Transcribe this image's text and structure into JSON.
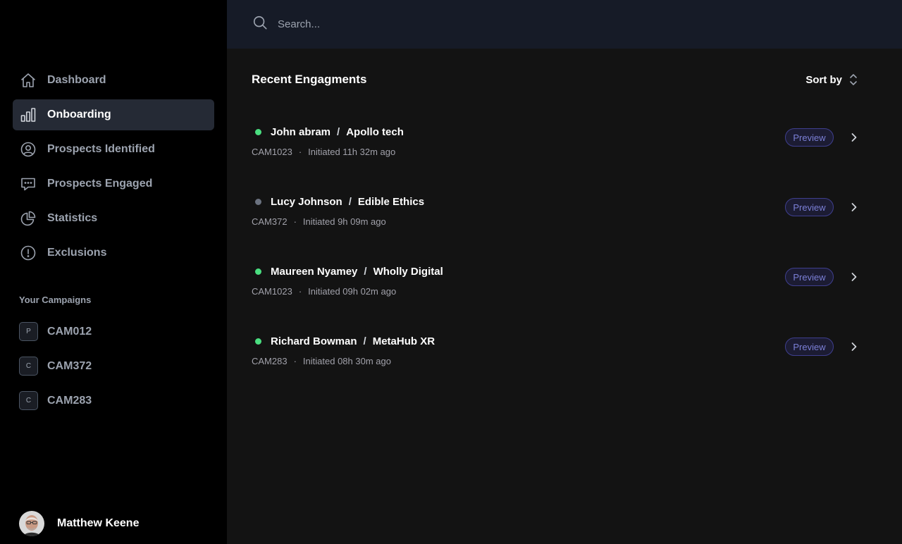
{
  "sidebar": {
    "nav": [
      {
        "label": "Dashboard",
        "icon": "home-icon",
        "active": false
      },
      {
        "label": "Onboarding",
        "icon": "bar-chart-icon",
        "active": true
      },
      {
        "label": "Prospects Identified",
        "icon": "user-circle-icon",
        "active": false
      },
      {
        "label": "Prospects Engaged",
        "icon": "chat-bubble-icon",
        "active": false
      },
      {
        "label": "Statistics",
        "icon": "pie-chart-icon",
        "active": false
      },
      {
        "label": "Exclusions",
        "icon": "alert-circle-icon",
        "active": false
      }
    ],
    "campaigns_title": "Your Campaigns",
    "campaigns": [
      {
        "badge": "P",
        "label": "CAM012"
      },
      {
        "badge": "C",
        "label": "CAM372"
      },
      {
        "badge": "C",
        "label": "CAM283"
      }
    ],
    "user": {
      "name": "Matthew Keene"
    }
  },
  "search": {
    "placeholder": "Search..."
  },
  "main": {
    "title": "Recent Engagments",
    "sort_label": "Sort by",
    "preview_label": "Preview",
    "engagements": [
      {
        "name": "John abram",
        "company": "Apollo tech",
        "campaign": "CAM1023",
        "initiated": "Initiated 11h 32m ago",
        "status_color": "#4ade80"
      },
      {
        "name": "Lucy Johnson",
        "company": "Edible Ethics",
        "campaign": "CAM372",
        "initiated": "Initiated 9h 09m ago",
        "status_color": "#6b7280"
      },
      {
        "name": "Maureen Nyamey",
        "company": "Wholly Digital",
        "campaign": "CAM1023",
        "initiated": "Initiated 09h 02m ago",
        "status_color": "#4ade80"
      },
      {
        "name": "Richard Bowman",
        "company": "MetaHub XR",
        "campaign": "CAM283",
        "initiated": "Initiated 08h 30m ago",
        "status_color": "#4ade80"
      }
    ]
  },
  "colors": {
    "accent": "#7b7fd6",
    "active_bg": "#252a35",
    "online": "#4ade80",
    "offline": "#6b7280"
  }
}
